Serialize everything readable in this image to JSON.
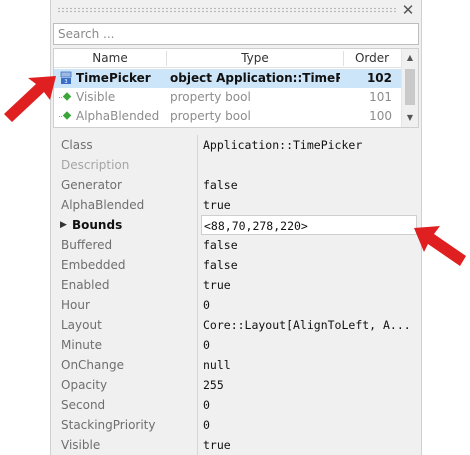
{
  "search": {
    "placeholder": "Search ...",
    "value": ""
  },
  "list": {
    "columns": {
      "name": "Name",
      "type": "Type",
      "order": "Order"
    },
    "rows": [
      {
        "name": "TimePicker",
        "type": "object Application::TimePicker",
        "order": "102",
        "icon": "object-icon"
      },
      {
        "name": "Visible",
        "type": "property bool",
        "order": "101",
        "icon": "property-icon"
      },
      {
        "name": "AlphaBlended",
        "type": "property bool",
        "order": "100",
        "icon": "property-icon"
      }
    ]
  },
  "properties": [
    {
      "name": "Class",
      "value": "Application::TimePicker"
    },
    {
      "name": "Description",
      "value": ""
    },
    {
      "name": "Generator",
      "value": "false"
    },
    {
      "name": "AlphaBlended",
      "value": "true"
    },
    {
      "name": "Bounds",
      "value": "<88,70,278,220>"
    },
    {
      "name": "Buffered",
      "value": "false"
    },
    {
      "name": "Embedded",
      "value": "false"
    },
    {
      "name": "Enabled",
      "value": "true"
    },
    {
      "name": "Hour",
      "value": "0"
    },
    {
      "name": "Layout",
      "value": "Core::Layout[AlignToLeft, A..."
    },
    {
      "name": "Minute",
      "value": "0"
    },
    {
      "name": "OnChange",
      "value": "null"
    },
    {
      "name": "Opacity",
      "value": "255"
    },
    {
      "name": "Second",
      "value": "0"
    },
    {
      "name": "StackingPriority",
      "value": "0"
    },
    {
      "name": "Visible",
      "value": "true"
    }
  ],
  "colors": {
    "selection": "#cde5f8",
    "arrow": "#e02020",
    "property_icon": "#3aa63a",
    "object_icon": "#3a6fc8"
  }
}
